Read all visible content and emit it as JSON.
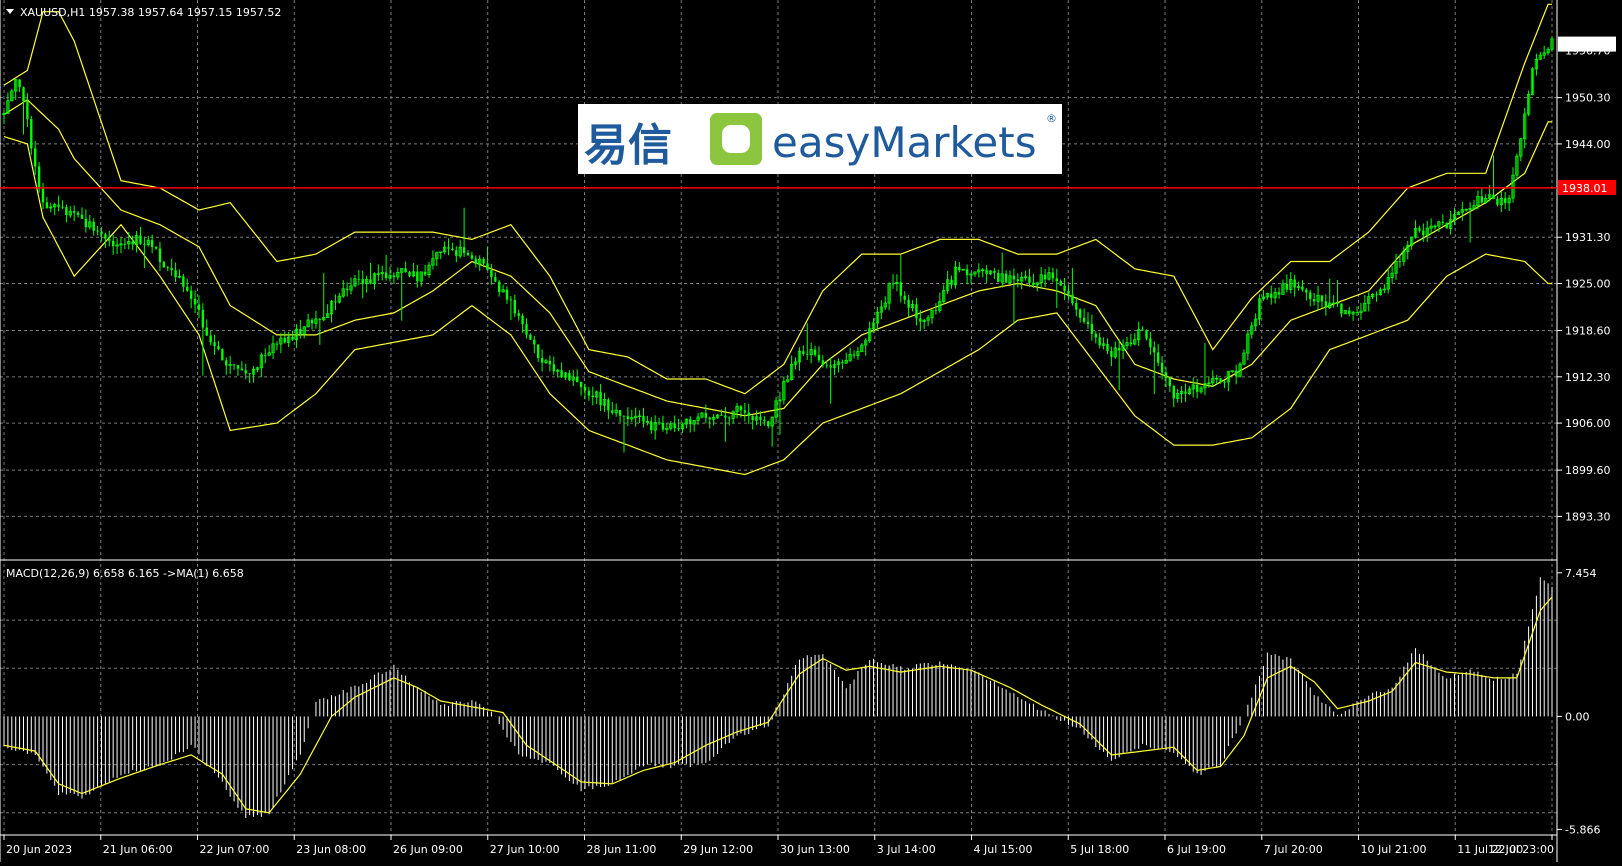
{
  "header": {
    "menu_icon": "triangle-down-icon",
    "symbol_line": "XAUUSD,H1  1957.38 1957.64 1957.15 1957.52"
  },
  "logo": {
    "chinese": "易信",
    "brand": "easyMarkets",
    "registered": "®",
    "icon": "rounded-square-logo-icon"
  },
  "colors": {
    "background": "#000000",
    "grid": "#7a7a7a",
    "candle": "#00ff00",
    "bollinger": "#ffff33",
    "hline": "#ff0000",
    "macd_hist": "#ffffff",
    "signal": "#ffff33"
  },
  "chart_data": [
    {
      "type": "candlestick",
      "name": "XAUUSD,H1",
      "ylim": [
        1889.0,
        1962.5
      ],
      "y_ticks": [
        "1950.30",
        "1944.00",
        "1931.30",
        "1925.00",
        "1918.60",
        "1912.30",
        "1906.00",
        "1899.60",
        "1893.30"
      ],
      "price_overlap_label": "1956.70",
      "current_price": "1957.52",
      "hline": {
        "value": 1938.01,
        "label": "1938.01"
      },
      "x_ticks": [
        "20 Jun 2023",
        "21 Jun 06:00",
        "22 Jun 07:00",
        "23 Jun 08:00",
        "26 Jun 09:00",
        "27 Jun 10:00",
        "28 Jun 11:00",
        "29 Jun 12:00",
        "30 Jun 13:00",
        "3 Jul 14:00",
        "4 Jul 15:00",
        "5 Jul 18:00",
        "6 Jul 19:00",
        "7 Jul 20:00",
        "10 Jul 21:00",
        "11 Jul 22:00",
        "12 Jul 23:00"
      ],
      "close_anchors": [
        [
          0,
          1948.0
        ],
        [
          3,
          1953.5
        ],
        [
          6,
          1947.0
        ],
        [
          10,
          1935.5
        ],
        [
          18,
          1935.0
        ],
        [
          26,
          1930.5
        ],
        [
          36,
          1931.0
        ],
        [
          46,
          1925.0
        ],
        [
          56,
          1914.5
        ],
        [
          62,
          1912.5
        ],
        [
          70,
          1916.5
        ],
        [
          80,
          1920.0
        ],
        [
          90,
          1925.0
        ],
        [
          98,
          1926.5
        ],
        [
          106,
          1926.0
        ],
        [
          114,
          1930.0
        ],
        [
          122,
          1928.0
        ],
        [
          130,
          1922.5
        ],
        [
          138,
          1914.0
        ],
        [
          146,
          1912.0
        ],
        [
          156,
          1908.0
        ],
        [
          164,
          1906.0
        ],
        [
          172,
          1905.0
        ],
        [
          180,
          1907.0
        ],
        [
          188,
          1907.5
        ],
        [
          196,
          1905.5
        ],
        [
          204,
          1916.5
        ],
        [
          212,
          1914.0
        ],
        [
          220,
          1916.0
        ],
        [
          228,
          1925.5
        ],
        [
          236,
          1919.5
        ],
        [
          244,
          1926.5
        ],
        [
          252,
          1926.5
        ],
        [
          260,
          1925.0
        ],
        [
          268,
          1926.0
        ],
        [
          276,
          1921.0
        ],
        [
          284,
          1915.0
        ],
        [
          292,
          1918.5
        ],
        [
          300,
          1910.0
        ],
        [
          308,
          1911.0
        ],
        [
          316,
          1913.0
        ],
        [
          322,
          1922.5
        ],
        [
          330,
          1925.0
        ],
        [
          338,
          1922.5
        ],
        [
          346,
          1920.5
        ],
        [
          354,
          1924.5
        ],
        [
          362,
          1932.0
        ],
        [
          370,
          1933.0
        ],
        [
          378,
          1936.5
        ],
        [
          386,
          1936.5
        ],
        [
          392,
          1954.0
        ],
        [
          396,
          1957.52
        ]
      ],
      "bb_upper": [
        [
          0,
          1952
        ],
        [
          6,
          1954
        ],
        [
          10,
          1962
        ],
        [
          14,
          1962
        ],
        [
          18,
          1958
        ],
        [
          30,
          1939
        ],
        [
          40,
          1938
        ],
        [
          50,
          1935
        ],
        [
          58,
          1936
        ],
        [
          70,
          1928
        ],
        [
          80,
          1929
        ],
        [
          90,
          1932
        ],
        [
          100,
          1932
        ],
        [
          110,
          1932
        ],
        [
          120,
          1931
        ],
        [
          130,
          1933
        ],
        [
          140,
          1926
        ],
        [
          150,
          1916
        ],
        [
          160,
          1915
        ],
        [
          170,
          1912
        ],
        [
          180,
          1912
        ],
        [
          190,
          1910
        ],
        [
          200,
          1914
        ],
        [
          210,
          1924
        ],
        [
          220,
          1929
        ],
        [
          230,
          1929
        ],
        [
          240,
          1931
        ],
        [
          250,
          1931
        ],
        [
          260,
          1929
        ],
        [
          270,
          1929
        ],
        [
          280,
          1931
        ],
        [
          290,
          1927
        ],
        [
          300,
          1926
        ],
        [
          310,
          1916
        ],
        [
          320,
          1923
        ],
        [
          330,
          1928
        ],
        [
          340,
          1928
        ],
        [
          350,
          1932
        ],
        [
          360,
          1938
        ],
        [
          370,
          1940
        ],
        [
          380,
          1940
        ],
        [
          390,
          1955
        ],
        [
          396,
          1963
        ]
      ],
      "bb_middle": [
        [
          0,
          1948
        ],
        [
          6,
          1950
        ],
        [
          10,
          1948
        ],
        [
          14,
          1946
        ],
        [
          18,
          1942
        ],
        [
          30,
          1935
        ],
        [
          40,
          1933
        ],
        [
          50,
          1930
        ],
        [
          58,
          1922
        ],
        [
          70,
          1918
        ],
        [
          80,
          1918
        ],
        [
          90,
          1920
        ],
        [
          100,
          1921
        ],
        [
          110,
          1924
        ],
        [
          120,
          1928
        ],
        [
          130,
          1926
        ],
        [
          140,
          1921
        ],
        [
          150,
          1913
        ],
        [
          160,
          1911
        ],
        [
          170,
          1909
        ],
        [
          180,
          1908
        ],
        [
          190,
          1907
        ],
        [
          200,
          1908
        ],
        [
          210,
          1914
        ],
        [
          220,
          1918
        ],
        [
          230,
          1920
        ],
        [
          240,
          1922
        ],
        [
          250,
          1924
        ],
        [
          260,
          1925
        ],
        [
          270,
          1924
        ],
        [
          280,
          1922
        ],
        [
          290,
          1914
        ],
        [
          300,
          1912
        ],
        [
          310,
          1911
        ],
        [
          320,
          1914
        ],
        [
          330,
          1920
        ],
        [
          340,
          1922
        ],
        [
          350,
          1924
        ],
        [
          360,
          1930
        ],
        [
          370,
          1933
        ],
        [
          380,
          1936
        ],
        [
          390,
          1940
        ],
        [
          396,
          1947
        ]
      ],
      "bb_lower": [
        [
          0,
          1945
        ],
        [
          6,
          1944
        ],
        [
          10,
          1934
        ],
        [
          14,
          1930
        ],
        [
          18,
          1926
        ],
        [
          30,
          1933
        ],
        [
          40,
          1926
        ],
        [
          50,
          1918
        ],
        [
          58,
          1905
        ],
        [
          70,
          1906
        ],
        [
          80,
          1910
        ],
        [
          90,
          1916
        ],
        [
          100,
          1917
        ],
        [
          110,
          1918
        ],
        [
          120,
          1922
        ],
        [
          130,
          1918
        ],
        [
          140,
          1910
        ],
        [
          150,
          1905
        ],
        [
          160,
          1903
        ],
        [
          170,
          1901
        ],
        [
          180,
          1900
        ],
        [
          190,
          1899
        ],
        [
          200,
          1901
        ],
        [
          210,
          1906
        ],
        [
          220,
          1908
        ],
        [
          230,
          1910
        ],
        [
          240,
          1913
        ],
        [
          250,
          1916
        ],
        [
          260,
          1920
        ],
        [
          270,
          1921
        ],
        [
          280,
          1914
        ],
        [
          290,
          1907
        ],
        [
          300,
          1903
        ],
        [
          310,
          1903
        ],
        [
          320,
          1904
        ],
        [
          330,
          1908
        ],
        [
          340,
          1916
        ],
        [
          350,
          1918
        ],
        [
          360,
          1920
        ],
        [
          370,
          1926
        ],
        [
          380,
          1929
        ],
        [
          390,
          1928
        ],
        [
          396,
          1925
        ]
      ]
    },
    {
      "type": "bar",
      "name": "MACD",
      "label": "MACD(12,26,9) 6.658 6.165  ->MA(1) 6.658",
      "ylim": [
        -6.0,
        7.6
      ],
      "y_ticks": [
        "7.454",
        "0.00",
        "-5.866"
      ],
      "macd_anchors": [
        [
          0,
          -1.5
        ],
        [
          8,
          -2.0
        ],
        [
          14,
          -4.0
        ],
        [
          20,
          -4.2
        ],
        [
          30,
          -3.0
        ],
        [
          40,
          -2.5
        ],
        [
          48,
          -1.5
        ],
        [
          56,
          -3.5
        ],
        [
          62,
          -5.3
        ],
        [
          68,
          -5.0
        ],
        [
          76,
          -2.0
        ],
        [
          80,
          0.8
        ],
        [
          90,
          1.5
        ],
        [
          100,
          2.6
        ],
        [
          106,
          1.5
        ],
        [
          112,
          0.6
        ],
        [
          120,
          0.8
        ],
        [
          126,
          0.0
        ],
        [
          132,
          -2.0
        ],
        [
          140,
          -2.5
        ],
        [
          148,
          -3.8
        ],
        [
          156,
          -3.5
        ],
        [
          164,
          -2.5
        ],
        [
          172,
          -2.6
        ],
        [
          180,
          -2.5
        ],
        [
          188,
          -1.0
        ],
        [
          196,
          -0.5
        ],
        [
          204,
          3.0
        ],
        [
          210,
          3.2
        ],
        [
          216,
          1.5
        ],
        [
          222,
          3.0
        ],
        [
          230,
          2.5
        ],
        [
          240,
          2.8
        ],
        [
          248,
          2.5
        ],
        [
          258,
          1.3
        ],
        [
          266,
          0.3
        ],
        [
          276,
          -0.7
        ],
        [
          284,
          -2.3
        ],
        [
          292,
          -1.5
        ],
        [
          300,
          -1.8
        ],
        [
          306,
          -3.0
        ],
        [
          312,
          -2.5
        ],
        [
          318,
          0.0
        ],
        [
          324,
          3.2
        ],
        [
          330,
          3.0
        ],
        [
          336,
          1.2
        ],
        [
          342,
          0.0
        ],
        [
          350,
          1.1
        ],
        [
          356,
          1.5
        ],
        [
          362,
          3.5
        ],
        [
          370,
          2.0
        ],
        [
          376,
          2.4
        ],
        [
          382,
          1.9
        ],
        [
          388,
          2.2
        ],
        [
          394,
          7.2
        ],
        [
          397,
          6.8
        ]
      ],
      "signal_anchors": [
        [
          0,
          -1.5
        ],
        [
          8,
          -1.8
        ],
        [
          14,
          -3.5
        ],
        [
          20,
          -4.0
        ],
        [
          30,
          -3.2
        ],
        [
          40,
          -2.5
        ],
        [
          48,
          -2.0
        ],
        [
          56,
          -3.0
        ],
        [
          62,
          -4.8
        ],
        [
          68,
          -5.0
        ],
        [
          76,
          -3.0
        ],
        [
          84,
          0.0
        ],
        [
          90,
          1.0
        ],
        [
          100,
          2.0
        ],
        [
          106,
          1.5
        ],
        [
          112,
          0.8
        ],
        [
          120,
          0.5
        ],
        [
          128,
          0.2
        ],
        [
          134,
          -1.5
        ],
        [
          140,
          -2.3
        ],
        [
          148,
          -3.4
        ],
        [
          156,
          -3.5
        ],
        [
          164,
          -2.8
        ],
        [
          172,
          -2.4
        ],
        [
          180,
          -1.5
        ],
        [
          188,
          -0.8
        ],
        [
          196,
          -0.3
        ],
        [
          204,
          2.2
        ],
        [
          210,
          3.0
        ],
        [
          216,
          2.4
        ],
        [
          222,
          2.6
        ],
        [
          230,
          2.3
        ],
        [
          240,
          2.6
        ],
        [
          248,
          2.4
        ],
        [
          258,
          1.5
        ],
        [
          266,
          0.6
        ],
        [
          276,
          -0.4
        ],
        [
          284,
          -2.0
        ],
        [
          292,
          -1.8
        ],
        [
          300,
          -1.6
        ],
        [
          306,
          -2.8
        ],
        [
          312,
          -2.6
        ],
        [
          318,
          -1.0
        ],
        [
          324,
          2.0
        ],
        [
          330,
          2.6
        ],
        [
          336,
          1.8
        ],
        [
          342,
          0.4
        ],
        [
          350,
          0.8
        ],
        [
          356,
          1.3
        ],
        [
          362,
          2.8
        ],
        [
          370,
          2.3
        ],
        [
          376,
          2.2
        ],
        [
          382,
          2.0
        ],
        [
          388,
          2.0
        ],
        [
          394,
          5.5
        ],
        [
          397,
          6.2
        ]
      ]
    }
  ]
}
